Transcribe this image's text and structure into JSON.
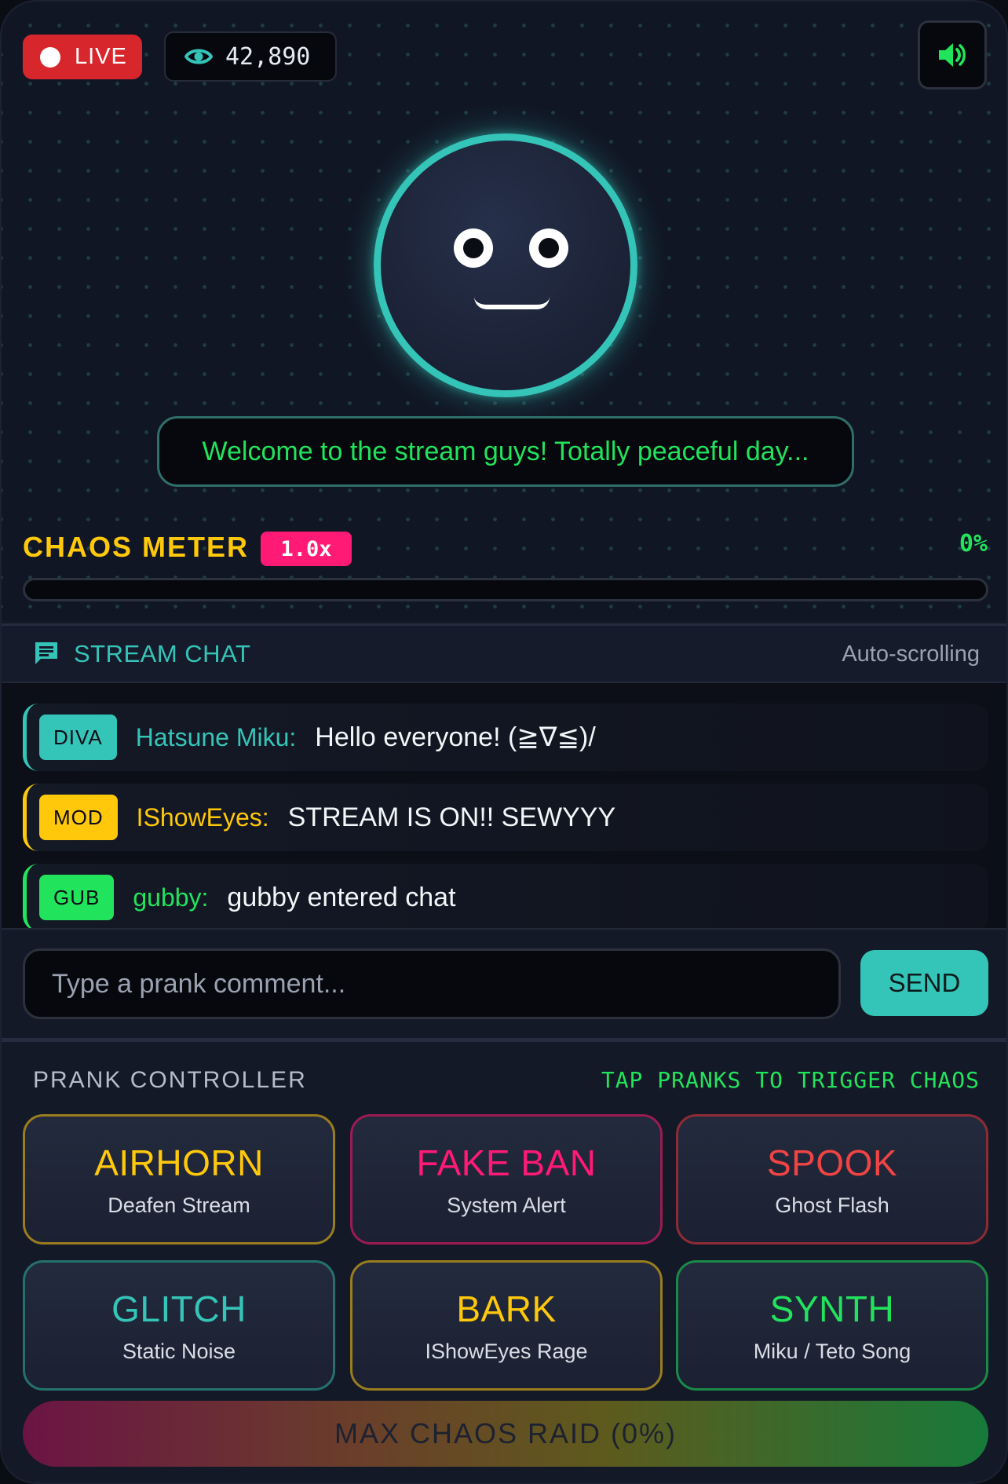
{
  "stream": {
    "live_label": "LIVE",
    "viewer_count": "42,890",
    "speech": "Welcome to the stream guys! Totally peaceful day...",
    "icons": {
      "live": "record-dot-icon",
      "viewers": "eye-icon",
      "sound": "speaker-volume-icon"
    }
  },
  "chaos": {
    "title": "CHAOS METER",
    "multiplier": "1.0x",
    "percent_label": "0%",
    "level": 0
  },
  "chat": {
    "title": "STREAM CHAT",
    "status": "Auto-scrolling",
    "messages": [
      {
        "badge": "DIVA",
        "name": "Hatsune Miku:",
        "text": "Hello everyone! (≧∇≦)/",
        "color": "#35c4b8"
      },
      {
        "badge": "MOD",
        "name": "IShowEyes:",
        "text": "STREAM IS ON!! SEWYYY",
        "color": "#ffc80a"
      },
      {
        "badge": "GUB",
        "name": "gubby:",
        "text": "gubby entered chat",
        "color": "#22e35c"
      }
    ],
    "input_placeholder": "Type a prank comment...",
    "send_label": "SEND"
  },
  "controller": {
    "title": "PRANK CONTROLLER",
    "hint": "TAP PRANKS TO TRIGGER CHAOS",
    "pranks": [
      {
        "name": "AIRHORN",
        "sub": "Deafen Stream",
        "color": "#ffc80a",
        "border": "#9a7d1e"
      },
      {
        "name": "FAKE BAN",
        "sub": "System Alert",
        "color": "#ff1a75",
        "border": "#9b1b52"
      },
      {
        "name": "SPOOK",
        "sub": "Ghost Flash",
        "color": "#f04444",
        "border": "#8f2b35"
      },
      {
        "name": "GLITCH",
        "sub": "Static Noise",
        "color": "#35c4b8",
        "border": "#25716d"
      },
      {
        "name": "BARK",
        "sub": "IShowEyes Rage",
        "color": "#ffc80a",
        "border": "#9a7d1e"
      },
      {
        "name": "SYNTH",
        "sub": "Miku / Teto Song",
        "color": "#22e35c",
        "border": "#1a8a48"
      }
    ],
    "raid_label": "MAX CHAOS RAID (0%)"
  },
  "colors": {
    "accent_teal": "#35c4b8",
    "accent_green": "#22e35c",
    "accent_yellow": "#ffc80a",
    "accent_pink": "#ff1a75",
    "live_red": "#d7262c"
  }
}
